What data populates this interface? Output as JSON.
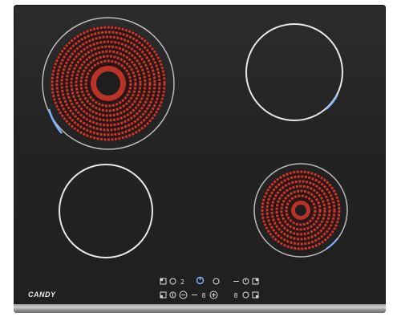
{
  "brand": {
    "name": "CANDY"
  },
  "colors": {
    "glass": "#232323",
    "zone_ring": "#d8d8d8",
    "heating_element": "#c8382d",
    "indicator_blue": "#6aa8ff",
    "trim": "#b8b8b8"
  },
  "zones": [
    {
      "id": "rear-left",
      "state": "on",
      "heat_level_fraction": 1.0
    },
    {
      "id": "rear-right",
      "state": "off",
      "heat_level_fraction": 0
    },
    {
      "id": "front-left",
      "state": "off",
      "heat_level_fraction": 0
    },
    {
      "id": "front-right",
      "state": "on",
      "heat_level_fraction": 1.0
    }
  ],
  "controls": {
    "left_group": [
      "zone-select-icon",
      "zone-select-icon",
      "key-lock-icon"
    ],
    "center_group": [
      "power-icon",
      "minus-icon",
      "plus-icon"
    ],
    "right_group": [
      "timer-icon",
      "zone-select-icon",
      "zone-select-icon"
    ]
  }
}
